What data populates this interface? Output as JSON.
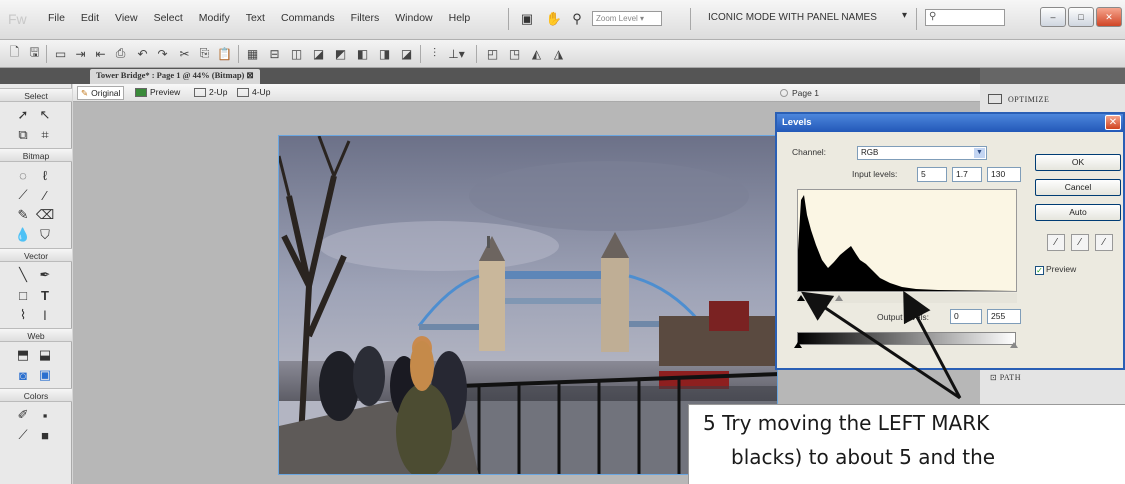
{
  "app": {
    "logo": "Fw",
    "menu": [
      "File",
      "Edit",
      "View",
      "Select",
      "Modify",
      "Text",
      "Commands",
      "Filters",
      "Window",
      "Help"
    ],
    "zoom_level": "Zoom Level",
    "workspace_mode": "ICONIC MODE WITH PANEL NAMES"
  },
  "document": {
    "tab_title": "Tower Bridge* : Page 1 @ 44% (Bitmap)",
    "view_tabs": [
      "Original",
      "Preview",
      "2-Up",
      "4-Up"
    ],
    "page_selector": "Page 1"
  },
  "tools": {
    "sections": [
      "Select",
      "Bitmap",
      "Vector",
      "Web",
      "Colors"
    ]
  },
  "right_panel": {
    "optimize_label": "OPTIMIZE",
    "path_label": "PATH"
  },
  "levels": {
    "title": "Levels",
    "channel_label": "Channel:",
    "channel_value": "RGB",
    "input_levels_label": "Input levels:",
    "input_black": "5",
    "input_gamma": "1.7",
    "input_white": "130",
    "output_levels_label": "Output levels:",
    "output_black": "0",
    "output_white": "255",
    "buttons": {
      "ok": "OK",
      "cancel": "Cancel",
      "auto": "Auto"
    },
    "preview_label": "Preview",
    "preview_checked": true
  },
  "callout": {
    "line1": "5  Try moving the LEFT MARK",
    "line2": "blacks) to about 5 and the"
  },
  "colors": {
    "title_bar": "#2358b8",
    "dialog_bg": "#eceae0",
    "canvas_bg": "#b7b7b7"
  }
}
